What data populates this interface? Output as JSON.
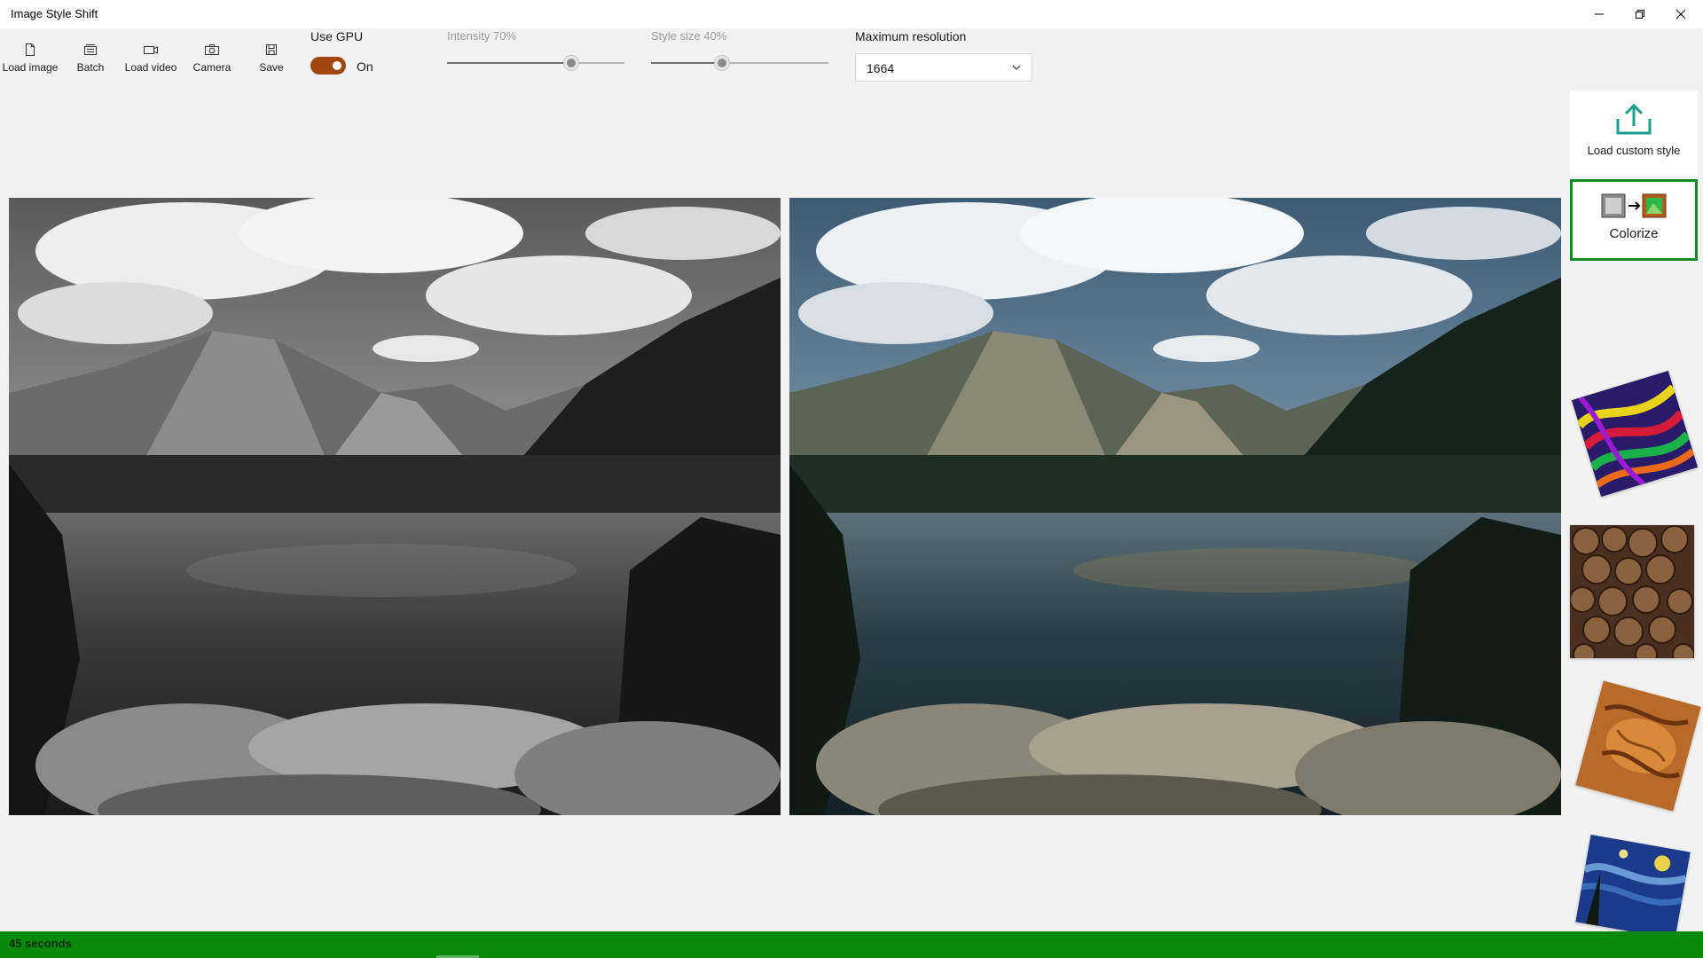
{
  "window": {
    "title": "Image Style Shift",
    "controls": [
      "minimize",
      "restore",
      "close"
    ]
  },
  "toolbar": {
    "buttons": [
      {
        "label": "Load image",
        "icon": "file-icon"
      },
      {
        "label": "Batch",
        "icon": "batch-icon"
      },
      {
        "label": "Load video",
        "icon": "video-icon"
      },
      {
        "label": "Camera",
        "icon": "camera-icon"
      },
      {
        "label": "Save",
        "icon": "save-icon"
      }
    ],
    "gpu": {
      "label": "Use GPU",
      "state": "On",
      "enabled": true
    },
    "intensity": {
      "label": "Intensity 70%",
      "value": 0.7
    },
    "style_size": {
      "label": "Style size 40%",
      "value": 0.4
    },
    "resolution": {
      "label": "Maximum resolution",
      "value": "1664"
    }
  },
  "panes": {
    "original": "grayscale-landscape",
    "result": "colorized-landscape"
  },
  "styles": {
    "custom": {
      "label": "Load custom style",
      "icon": "upload-icon"
    },
    "colorize": {
      "label": "Colorize",
      "icon": "colorize-icon",
      "selected": true
    },
    "thumbnails": [
      "psychedelic-swirl",
      "log-pile",
      "leather-texture",
      "starry-night"
    ]
  },
  "status": {
    "text": "45 seconds"
  },
  "colors": {
    "accent": "#a0460e",
    "selected_border": "#0f8a1f",
    "status_bar": "#0a8a0a",
    "upload_icon": "#1aa08a"
  }
}
